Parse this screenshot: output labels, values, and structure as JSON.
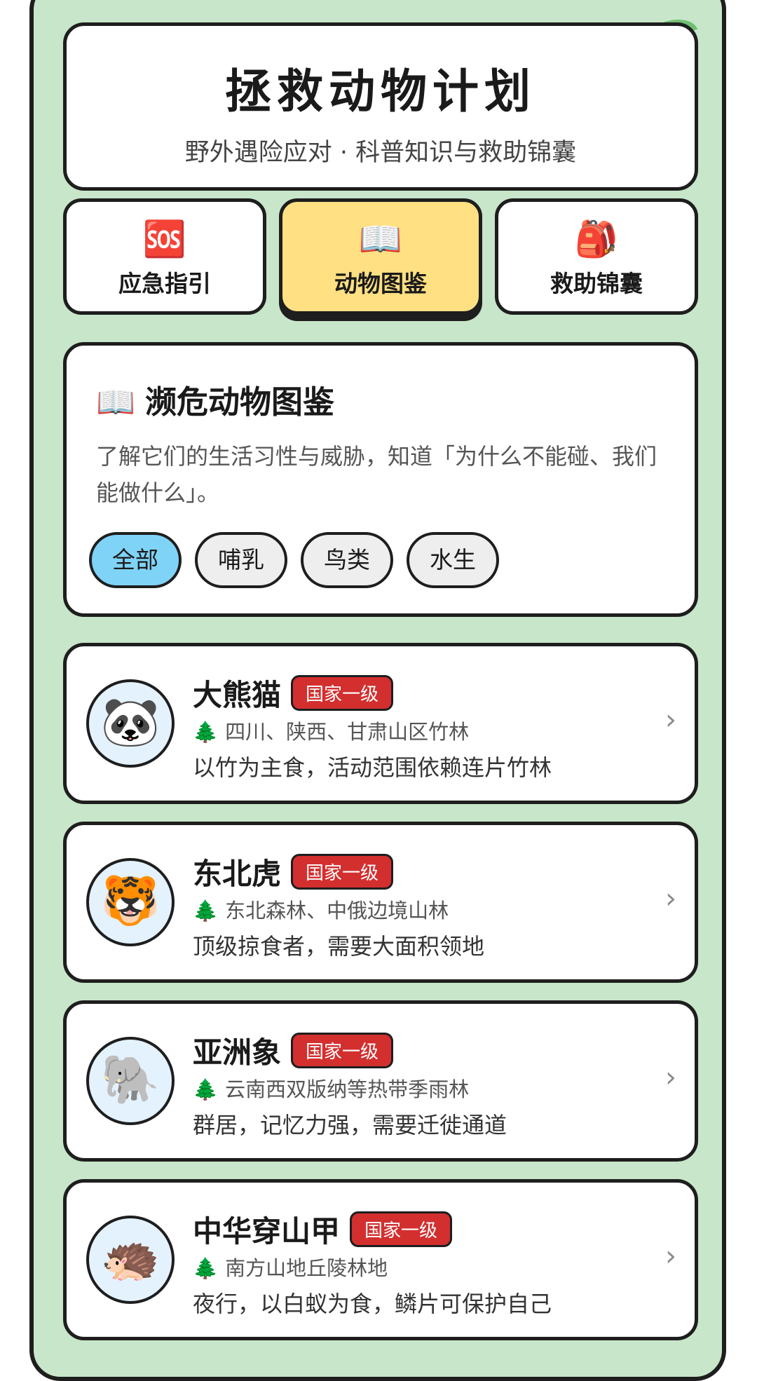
{
  "header": {
    "title": "拯救动物计划",
    "subtitle": "野外遇险应对 · 科普知识与救助锦囊"
  },
  "tabs": [
    {
      "icon": "🆘",
      "icon_name": "sos-icon",
      "label": "应急指引",
      "active": false
    },
    {
      "icon": "📖",
      "icon_name": "open-book-icon",
      "label": "动物图鉴",
      "active": true
    },
    {
      "icon": "🎒",
      "icon_name": "backpack-icon",
      "label": "救助锦囊",
      "active": false
    }
  ],
  "intro": {
    "icon": "📖",
    "title": "濒危动物图鉴",
    "description": "了解它们的生活习性与威胁，知道「为什么不能碰、我们能做什么」。"
  },
  "filters": [
    {
      "label": "全部",
      "active": true
    },
    {
      "label": "哺乳",
      "active": false
    },
    {
      "label": "鸟类",
      "active": false
    },
    {
      "label": "水生",
      "active": false
    }
  ],
  "animals": [
    {
      "emoji": "🐼",
      "icon_name": "panda-icon",
      "name": "大熊猫",
      "badge": "国家一级",
      "tree": "🌲",
      "habitat": "四川、陕西、甘肃山区竹林",
      "description": "以竹为主食，活动范围依赖连片竹林"
    },
    {
      "emoji": "🐯",
      "icon_name": "tiger-icon",
      "name": "东北虎",
      "badge": "国家一级",
      "tree": "🌲",
      "habitat": "东北森林、中俄边境山林",
      "description": "顶级掠食者，需要大面积领地"
    },
    {
      "emoji": "🐘",
      "icon_name": "elephant-icon",
      "name": "亚洲象",
      "badge": "国家一级",
      "tree": "🌲",
      "habitat": "云南西双版纳等热带季雨林",
      "description": "群居，记忆力强，需要迁徙通道"
    },
    {
      "emoji": "🦔",
      "icon_name": "pangolin-icon",
      "name": "中华穿山甲",
      "badge": "国家一级",
      "tree": "🌲",
      "habitat": "南方山地丘陵林地",
      "description": "夜行，以白蚁为食，鳞片可保护自己"
    }
  ],
  "chevron": "›",
  "colors": {
    "background": "#c8e6c9",
    "active_tab": "#ffe082",
    "active_chip": "#7fd3f7",
    "badge": "#d32f2f"
  }
}
